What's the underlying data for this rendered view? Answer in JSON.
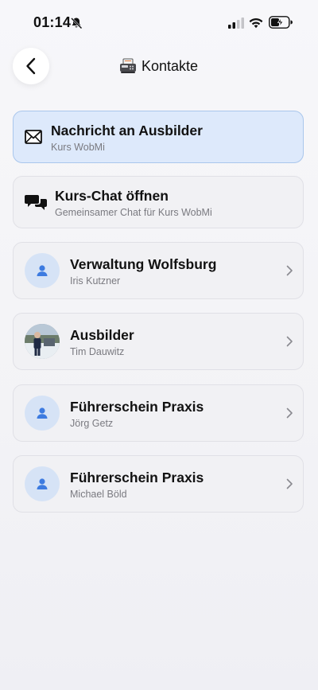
{
  "status_bar": {
    "time": "01:14",
    "icons": [
      "bell-slash-icon",
      "cellular-signal-icon",
      "wifi-icon",
      "battery-charging-icon"
    ]
  },
  "header": {
    "title": "Kontakte",
    "title_icon": "fax-icon",
    "back_icon": "chevron-left-icon"
  },
  "actions": [
    {
      "title": "Nachricht an Ausbilder",
      "subtitle": "Kurs WobMi",
      "icon": "envelope-icon",
      "highlighted": true
    },
    {
      "title": "Kurs-Chat öffnen",
      "subtitle": "Gemeinsamer Chat für Kurs WobMi",
      "icon": "chat-bubbles-icon",
      "highlighted": false
    }
  ],
  "contacts": [
    {
      "title": "Verwaltung Wolfsburg",
      "name": "Iris Kutzner",
      "avatar": "person-icon"
    },
    {
      "title": "Ausbilder",
      "name": "Tim Dauwitz",
      "avatar": "photo-avatar"
    },
    {
      "title": "Führerschein Praxis",
      "name": "Jörg Getz",
      "avatar": "person-icon"
    },
    {
      "title": "Führerschein Praxis",
      "name": "Michael Böld",
      "avatar": "person-icon"
    }
  ],
  "colors": {
    "highlight_bg": "#dde9fb",
    "highlight_border": "#a9c6ec",
    "card_bg": "#f1f1f4",
    "avatar_bg": "#d6e3f6",
    "accent_blue": "#3d7be0"
  }
}
